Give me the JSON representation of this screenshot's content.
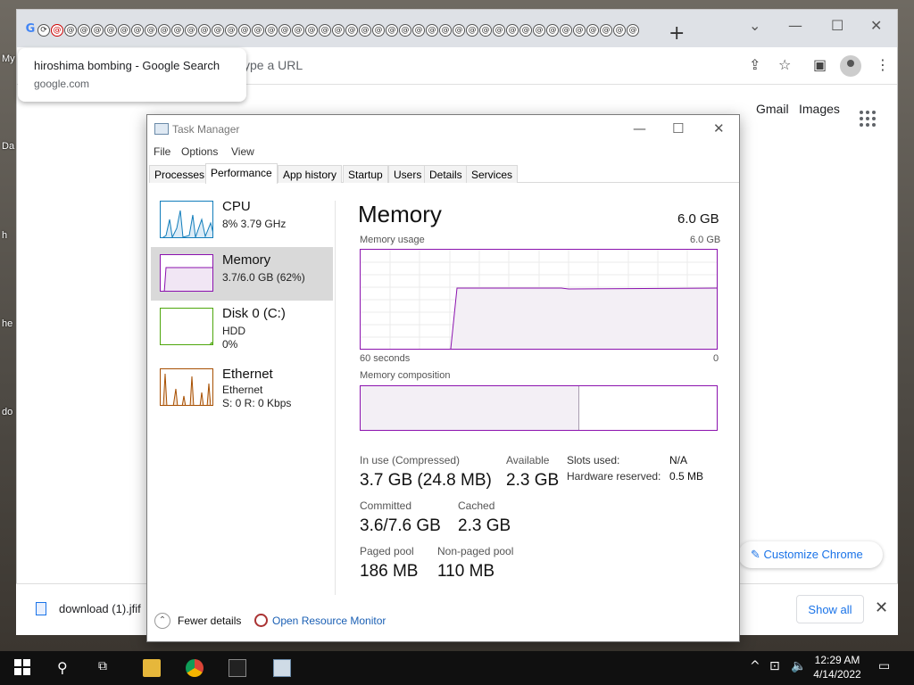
{
  "desktop": {
    "icon_labels": [
      "My",
      "Da",
      "h",
      "he",
      "do"
    ]
  },
  "chrome": {
    "omnibox_placeholder_fragment": "ype a URL",
    "suggestion": {
      "title": "hiroshima bombing - Google Search",
      "url": "google.com"
    },
    "header_links": {
      "gmail": "Gmail",
      "images": "Images"
    },
    "customize_label": "Customize Chrome",
    "downloads": {
      "file": "download (1).jfif",
      "show_all": "Show all"
    },
    "new_tab_glyph": "+",
    "icons": {
      "share": "share-icon",
      "star": "bookmark-star-icon",
      "sidepanel": "side-panel-icon",
      "menu": "kebab-menu-icon"
    }
  },
  "taskmgr": {
    "title": "Task Manager",
    "menu": [
      "File",
      "Options",
      "View"
    ],
    "tabs": [
      "Processes",
      "Performance",
      "App history",
      "Startup",
      "Users",
      "Details",
      "Services"
    ],
    "active_tab": "Performance",
    "sidebar": [
      {
        "name": "CPU",
        "lines": [
          "8%  3.79 GHz"
        ],
        "color": "#117dbb"
      },
      {
        "name": "Memory",
        "lines": [
          "3.7/6.0 GB (62%)"
        ],
        "color": "#8b12ae"
      },
      {
        "name": "Disk 0 (C:)",
        "lines": [
          "HDD",
          "0%"
        ],
        "color": "#4da60c"
      },
      {
        "name": "Ethernet",
        "lines": [
          "Ethernet",
          "S: 0  R: 0 Kbps"
        ],
        "color": "#a74f01"
      }
    ],
    "main": {
      "title": "Memory",
      "total": "6.0 GB",
      "usage_label": "Memory usage",
      "usage_max": "6.0 GB",
      "axis_left": "60 seconds",
      "axis_right": "0",
      "composition_label": "Memory composition",
      "composition_in_use_fraction": 0.615
    },
    "stats": {
      "in_use": {
        "label": "In use (Compressed)",
        "value": "3.7 GB (24.8 MB)"
      },
      "available": {
        "label": "Available",
        "value": "2.3 GB"
      },
      "committed": {
        "label": "Committed",
        "value": "3.6/7.6 GB"
      },
      "cached": {
        "label": "Cached",
        "value": "2.3 GB"
      },
      "paged": {
        "label": "Paged pool",
        "value": "186 MB"
      },
      "nonpaged": {
        "label": "Non-paged pool",
        "value": "110 MB"
      },
      "slots_label": "Slots used:",
      "slots_value": "N/A",
      "hw_label": "Hardware reserved:",
      "hw_value": "0.5 MB"
    },
    "footer": {
      "fewer": "Fewer details",
      "monitor": "Open Resource Monitor"
    }
  },
  "taskbar": {
    "time": "12:29 AM",
    "date": "4/14/2022"
  }
}
